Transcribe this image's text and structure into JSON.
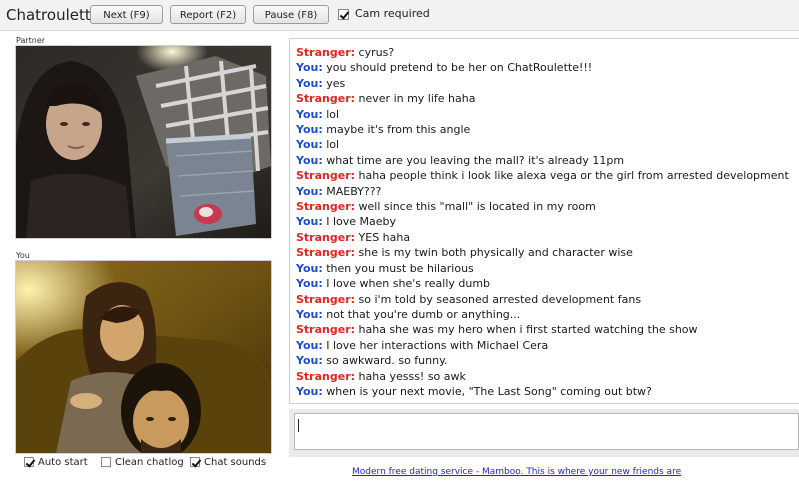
{
  "app": {
    "title": "Chatroulette"
  },
  "toolbar": {
    "next_label": "Next (F9)",
    "report_label": "Report (F2)",
    "pause_label": "Pause (F8)",
    "cam_required_label": "Cam required",
    "cam_required_checked": true
  },
  "partner": {
    "label": "Partner"
  },
  "you": {
    "label": "You"
  },
  "chat": {
    "messages": [
      {
        "who": "Stranger:",
        "text": " cyrus?"
      },
      {
        "who": "You:",
        "text": " you should pretend to be her on ChatRoulette!!!"
      },
      {
        "who": "You:",
        "text": " yes"
      },
      {
        "who": "Stranger:",
        "text": " never in my life haha"
      },
      {
        "who": "You:",
        "text": " lol"
      },
      {
        "who": "You:",
        "text": " maybe it's from this angle"
      },
      {
        "who": "You:",
        "text": " lol"
      },
      {
        "who": "You:",
        "text": " what time are you leaving the mall? it's already 11pm"
      },
      {
        "who": "Stranger:",
        "text": " haha people think i look like alexa vega or the girl from arrested development"
      },
      {
        "who": "You:",
        "text": " MAEBY???"
      },
      {
        "who": "Stranger:",
        "text": " well since this \"mall\" is located in my room"
      },
      {
        "who": "You:",
        "text": " I love Maeby"
      },
      {
        "who": "Stranger:",
        "text": " YES haha"
      },
      {
        "who": "Stranger:",
        "text": " she is my twin both physically and character wise"
      },
      {
        "who": "You:",
        "text": " then you must be hilarious"
      },
      {
        "who": "You:",
        "text": " I love when she's really dumb"
      },
      {
        "who": "Stranger:",
        "text": " so i'm told by seasoned arrested development fans"
      },
      {
        "who": "You:",
        "text": " not that you're dumb or anything..."
      },
      {
        "who": "Stranger:",
        "text": " haha she was my hero when i first started watching the show"
      },
      {
        "who": "You:",
        "text": " I love her interactions with Michael Cera"
      },
      {
        "who": "You:",
        "text": " so awkward. so funny."
      },
      {
        "who": "Stranger:",
        "text": " haha yesss! so awk"
      },
      {
        "who": "You:",
        "text": " when is your next movie, \"The Last Song\" coming out btw?"
      }
    ],
    "input_value": ""
  },
  "options": {
    "auto_start_label": "Auto start",
    "auto_start_checked": true,
    "clean_chatlog_label": "Clean chatlog",
    "clean_chatlog_checked": false,
    "chat_sounds_label": "Chat sounds",
    "chat_sounds_checked": true
  },
  "ad": {
    "text": "Modern free dating service - Mamboo. This is where your new friends are"
  },
  "colors": {
    "stranger": "#e4261f",
    "you": "#1e4ccf",
    "link": "#2424cc"
  }
}
